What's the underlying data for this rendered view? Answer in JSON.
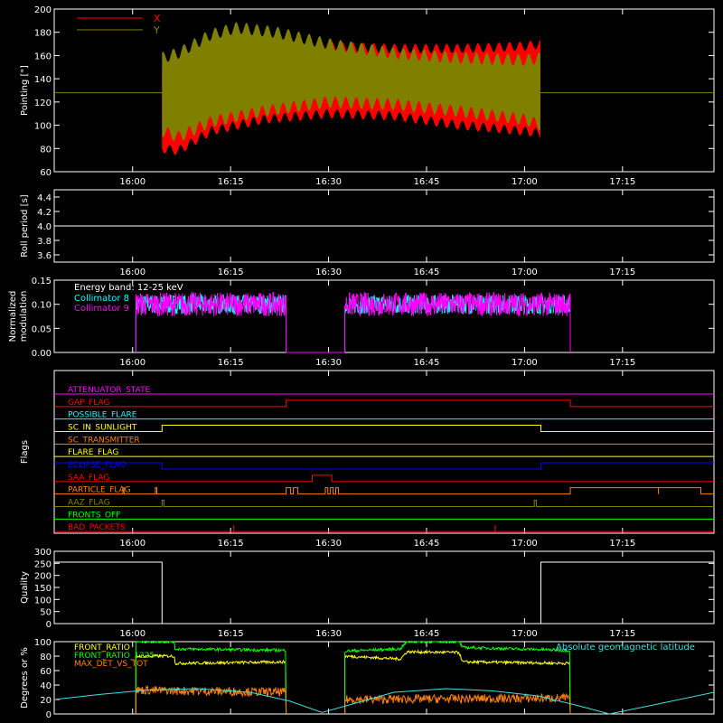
{
  "colors": {
    "background": "#000000",
    "axes": "#ffffff",
    "red": "#ff0000",
    "olive": "#808000",
    "white": "#ffffff",
    "cyan": "#00ffff",
    "magenta": "#ff00ff",
    "orange": "#ff8000",
    "yellow": "#ffff00",
    "blue": "#0000ff",
    "green": "#00ff00",
    "light_cyan": "#40e0e0"
  },
  "time_axis": {
    "ticks": [
      "16:00",
      "16:15",
      "16:30",
      "16:45",
      "17:00",
      "17:15"
    ],
    "tick_minutes": [
      960,
      975,
      990,
      1005,
      1020,
      1035
    ],
    "range_minutes": [
      948,
      1049
    ]
  },
  "chart_data": [
    {
      "type": "area",
      "ylabel": "Pointing [\"]",
      "ylim": [
        60,
        200
      ],
      "yticks": [
        "60",
        "80",
        "100",
        "120",
        "140",
        "160",
        "180",
        "200"
      ],
      "yvals": [
        60,
        80,
        100,
        120,
        140,
        160,
        180,
        200
      ],
      "legend": [
        "X",
        "Y"
      ],
      "legend_placement": "top-left",
      "center": 128,
      "start_minute": 964.5,
      "end_minute": 1022.5,
      "series": [
        {
          "name": "X",
          "color": "red",
          "upper": [
            [
              964.5,
              150
            ],
            [
              967,
              150
            ],
            [
              972,
              158
            ],
            [
              980,
              165
            ],
            [
              990,
              168
            ],
            [
              1000,
              166
            ],
            [
              1010,
              166
            ],
            [
              1020,
              168
            ],
            [
              1022.5,
              170
            ]
          ],
          "lower": [
            [
              964.5,
              80
            ],
            [
              967,
              78
            ],
            [
              972,
              95
            ],
            [
              980,
              105
            ],
            [
              990,
              110
            ],
            [
              1000,
              108
            ],
            [
              1010,
              100
            ],
            [
              1020,
              95
            ],
            [
              1022.5,
              93
            ]
          ]
        },
        {
          "name": "Y",
          "color": "olive",
          "upper": [
            [
              964.5,
              158
            ],
            [
              967,
              162
            ],
            [
              972,
              178
            ],
            [
              976,
              184
            ],
            [
              982,
              180
            ],
            [
              990,
              170
            ],
            [
              1000,
              162
            ],
            [
              1010,
              158
            ],
            [
              1020,
              156
            ],
            [
              1022.5,
              158
            ]
          ],
          "lower": [
            [
              964.5,
              95
            ],
            [
              967,
              90
            ],
            [
              972,
              103
            ],
            [
              980,
              112
            ],
            [
              990,
              120
            ],
            [
              1000,
              118
            ],
            [
              1010,
              112
            ],
            [
              1020,
              105
            ],
            [
              1022.5,
              100
            ]
          ]
        }
      ]
    },
    {
      "type": "line",
      "ylabel": "Roll period [s]",
      "ylim": [
        3.5,
        4.5
      ],
      "yticks": [
        "3.6",
        "3.8",
        "4.0",
        "4.2",
        "4.4"
      ],
      "yvals": [
        3.6,
        3.8,
        4.0,
        4.2,
        4.4
      ],
      "series": [
        {
          "name": "",
          "color": "white",
          "points": [
            [
              948,
              4.0
            ],
            [
              1049,
              4.0
            ]
          ]
        }
      ]
    },
    {
      "type": "line",
      "ylabel": "Normalized modulation",
      "ylim": [
        0,
        0.15
      ],
      "yticks": [
        "0.00",
        "0.05",
        "0.10",
        "0.15"
      ],
      "yvals": [
        0,
        0.05,
        0.1,
        0.15
      ],
      "legend_title": "Energy band: 12-25 keV",
      "legend": [
        "Collimator 8",
        "Collimator 9"
      ],
      "legend_placement": "top-left",
      "segments": [
        [
          960.5,
          983.5
        ],
        [
          992.5,
          1027
        ]
      ],
      "series": [
        {
          "name": "Collimator 8",
          "color": "cyan",
          "mean": 0.1,
          "spread": 0.02
        },
        {
          "name": "Collimator 9",
          "color": "magenta",
          "mean": 0.1,
          "spread": 0.025
        }
      ]
    },
    {
      "type": "line",
      "ylabel": "Flags",
      "flags": [
        {
          "name": "ATTENUATOR_STATE",
          "color": "magenta",
          "changes": []
        },
        {
          "name": "GAP_FLAG",
          "color": "red",
          "changes": [
            [
              983.5,
              1
            ],
            [
              1027,
              0
            ]
          ],
          "initial": 0
        },
        {
          "name": "POSSIBLE_FLARE",
          "color": "cyan",
          "changes": []
        },
        {
          "name": "SC_IN_SUNLIGHT",
          "color": "yellow",
          "changes": [
            [
              964.5,
              1
            ],
            [
              1022.5,
              0
            ]
          ],
          "initial": 0
        },
        {
          "name": "SC_TRANSMITTER",
          "color": "orange",
          "changes": []
        },
        {
          "name": "FLARE_FLAG",
          "color": "yellow",
          "changes": []
        },
        {
          "name": "ECLIPSE_FLAG",
          "color": "blue",
          "changes": [
            [
              964.5,
              0
            ],
            [
              1022.5,
              1
            ]
          ],
          "initial": 1
        },
        {
          "name": "SAA_FLAG",
          "color": "red",
          "changes": [
            [
              987.5,
              1
            ],
            [
              990.5,
              0
            ]
          ],
          "initial": 0
        },
        {
          "name": "PARTICLE_FLAG",
          "color": "orange",
          "changes": [
            [
              958.5,
              1
            ],
            [
              958.7,
              0
            ],
            [
              963.5,
              1
            ],
            [
              963.7,
              0
            ],
            [
              983.5,
              1
            ],
            [
              984.2,
              0
            ],
            [
              984.6,
              1
            ],
            [
              985.3,
              0
            ],
            [
              989.5,
              1
            ],
            [
              989.9,
              0
            ],
            [
              990.3,
              1
            ],
            [
              990.7,
              0
            ],
            [
              991.1,
              1
            ],
            [
              991.5,
              0
            ],
            [
              1027,
              1
            ],
            [
              1047,
              0
            ]
          ],
          "initial": 0,
          "spikes": [
            1040.5
          ]
        },
        {
          "name": "AAZ_FLAG",
          "color": "olive",
          "changes": [
            [
              964.5,
              1
            ],
            [
              964.8,
              0
            ],
            [
              1021.5,
              1
            ],
            [
              1021.8,
              0
            ]
          ],
          "initial": 0
        },
        {
          "name": "FRONTS_OFF",
          "color": "green",
          "changes": []
        },
        {
          "name": "BAD_PACKETS",
          "color": "red",
          "changes": [],
          "spikes": [
            975.5,
            1015.5
          ]
        }
      ]
    },
    {
      "type": "line",
      "ylabel": "Quality",
      "ylim": [
        0,
        300
      ],
      "yticks": [
        "0",
        "50",
        "100",
        "150",
        "200",
        "250",
        "300"
      ],
      "yvals": [
        0,
        50,
        100,
        150,
        200,
        250,
        300
      ],
      "series": [
        {
          "name": "",
          "color": "white",
          "points": [
            [
              948,
              255
            ],
            [
              964.5,
              255
            ],
            [
              964.5,
              0
            ],
            [
              1022.5,
              0
            ],
            [
              1022.5,
              255
            ],
            [
              1049,
              255
            ]
          ]
        }
      ]
    },
    {
      "type": "line",
      "ylabel": "Degrees or %",
      "ylim": [
        0,
        100
      ],
      "yticks": [
        "0",
        "20",
        "40",
        "60",
        "80",
        "100"
      ],
      "yvals": [
        0,
        20,
        40,
        60,
        80,
        100
      ],
      "legend": [
        "FRONT_RATIO",
        "FRONT_RATIO_1225",
        "MAX_DET_VS_TOT"
      ],
      "legend_placement": "top-left",
      "latitude_label": "Absolute geomagnetic latitude",
      "series": [
        {
          "name": "FRONT_RATIO",
          "color": "yellow",
          "segments": [
            [
              [
                960.5,
                80
              ],
              [
                966.5,
                80
              ],
              [
                966.5,
                70
              ],
              [
                983.5,
                72
              ]
            ],
            [
              [
                992.5,
                80
              ],
              [
                1001,
                76
              ],
              [
                1002,
                86
              ],
              [
                1010,
                85
              ],
              [
                1010.5,
                72
              ],
              [
                1027,
                70
              ]
            ]
          ]
        },
        {
          "name": "FRONT_RATIO_1225",
          "color": "green",
          "segments": [
            [
              [
                960.5,
                100
              ],
              [
                966.5,
                100
              ],
              [
                966.5,
                90
              ],
              [
                983.5,
                88
              ]
            ],
            [
              [
                992.5,
                87
              ],
              [
                1001,
                90
              ],
              [
                1002,
                100
              ],
              [
                1010,
                100
              ],
              [
                1010.5,
                92
              ],
              [
                1027,
                88
              ]
            ]
          ]
        },
        {
          "name": "MAX_DET_VS_TOT",
          "color": "orange",
          "segments": [
            [
              [
                960.5,
                33
              ],
              [
                983.5,
                30
              ]
            ],
            [
              [
                992.5,
                20
              ],
              [
                1027,
                22
              ]
            ]
          ]
        },
        {
          "name": "Absolute geomagnetic latitude",
          "color": "light_cyan",
          "points": [
            [
              948,
              20
            ],
            [
              955,
              27
            ],
            [
              962,
              33
            ],
            [
              970,
              35
            ],
            [
              978,
              30
            ],
            [
              984,
              18
            ],
            [
              989,
              2
            ],
            [
              993,
              12
            ],
            [
              1000,
              30
            ],
            [
              1008,
              35
            ],
            [
              1015,
              32
            ],
            [
              1022,
              25
            ],
            [
              1028,
              12
            ],
            [
              1033,
              0
            ],
            [
              1040,
              13
            ],
            [
              1049,
              30
            ]
          ]
        }
      ]
    }
  ]
}
